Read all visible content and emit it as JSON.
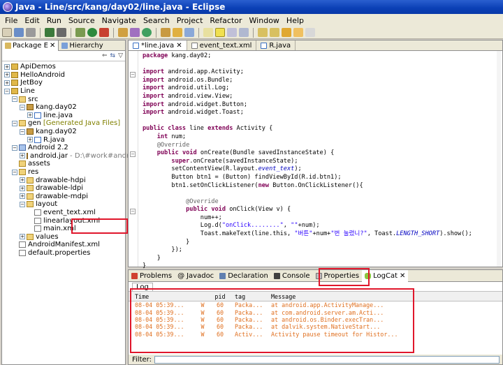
{
  "window": {
    "title": "Java - Line/src/kang/day02/line.java - Eclipse"
  },
  "menu": [
    "File",
    "Edit",
    "Run",
    "Source",
    "Navigate",
    "Search",
    "Project",
    "Refactor",
    "Window",
    "Help"
  ],
  "left_panel": {
    "tab_package": "Package E",
    "tab_hierarchy": "Hierarchy",
    "tree": [
      {
        "label": "ApiDemos",
        "icon": "project-icon",
        "depth": 0,
        "exp": "+"
      },
      {
        "label": "HelloAndroid",
        "icon": "project-icon",
        "depth": 0,
        "exp": "+"
      },
      {
        "label": "JetBoy",
        "icon": "project-icon",
        "depth": 0,
        "exp": "+"
      },
      {
        "label": "Line",
        "icon": "project-icon",
        "depth": 0,
        "exp": "-"
      },
      {
        "label": "src",
        "icon": "folder-icon",
        "depth": 1,
        "exp": "-"
      },
      {
        "label": "kang.day02",
        "icon": "package-icon",
        "depth": 2,
        "exp": "-"
      },
      {
        "label": "line.java",
        "icon": "java-file-icon",
        "depth": 3,
        "exp": "+"
      },
      {
        "label": "gen",
        "extra": "[Generated Java Files]",
        "icon": "folder-icon",
        "depth": 1,
        "exp": "-"
      },
      {
        "label": "kang.day02",
        "icon": "package-icon",
        "depth": 2,
        "exp": "-"
      },
      {
        "label": "R.java",
        "icon": "java-file-icon",
        "depth": 3,
        "exp": "+"
      },
      {
        "label": "Android 2.2",
        "icon": "library-icon",
        "depth": 1,
        "exp": "-"
      },
      {
        "label": "android.jar",
        "extra": "- D:\\#work#andro",
        "icon": "jar-icon",
        "depth": 2,
        "exp": "+"
      },
      {
        "label": "assets",
        "icon": "folder-icon",
        "depth": 1,
        "exp": ""
      },
      {
        "label": "res",
        "icon": "folder-icon",
        "depth": 1,
        "exp": "-"
      },
      {
        "label": "drawable-hdpi",
        "icon": "folder-icon",
        "depth": 2,
        "exp": "+"
      },
      {
        "label": "drawable-ldpi",
        "icon": "folder-icon",
        "depth": 2,
        "exp": "+"
      },
      {
        "label": "drawable-mdpi",
        "icon": "folder-icon",
        "depth": 2,
        "exp": "+"
      },
      {
        "label": "layout",
        "icon": "folder-icon",
        "depth": 2,
        "exp": "-"
      },
      {
        "label": "event_text.xml",
        "icon": "xml-file-icon",
        "depth": 3,
        "exp": ""
      },
      {
        "label": "linearlayout.xml",
        "icon": "xml-file-icon",
        "depth": 3,
        "exp": ""
      },
      {
        "label": "main.xml",
        "icon": "xml-file-icon",
        "depth": 3,
        "exp": ""
      },
      {
        "label": "values",
        "icon": "folder-icon",
        "depth": 2,
        "exp": "+"
      },
      {
        "label": "AndroidManifest.xml",
        "icon": "xml-file-icon",
        "depth": 1,
        "exp": ""
      },
      {
        "label": "default.properties",
        "icon": "xml-file-icon",
        "depth": 1,
        "exp": ""
      }
    ]
  },
  "editor": {
    "tabs": [
      "*line.java",
      "event_text.xml",
      "R.java"
    ],
    "lines": [
      "package kang.day02;",
      "",
      "import android.app.Activity;",
      "import android.os.Bundle;",
      "import android.util.Log;",
      "import android.view.View;",
      "import android.widget.Button;",
      "import android.widget.Toast;",
      "",
      "public class line extends Activity {",
      "    int num;",
      "    @Override",
      "    public void onCreate(Bundle savedInstanceState) {",
      "        super.onCreate(savedInstanceState);",
      "        setContentView(R.layout.event_text);",
      "        Button btn1 = (Button) findViewById(R.id.btn1);",
      "        btn1.setOnClickListener(new Button.OnClickListener(){",
      "",
      "            @Override",
      "            public void onClick(View v) {",
      "                num++;",
      "                Log.d(\"onClick........\", \"\"+num);",
      "                Toast.makeText(line.this, \"버튼\"+num+\"번 눌렸니?\", Toast.LENGTH_SHORT).show();",
      "            }",
      "        });",
      "    }",
      "}"
    ]
  },
  "bottom_panel": {
    "tabs": [
      "Problems",
      "Javadoc",
      "Declaration",
      "Console",
      "Properties",
      "LogCat"
    ],
    "sub_tab": "Log",
    "columns": [
      "Time",
      "",
      "pid",
      "tag",
      "Message"
    ],
    "rows": [
      {
        "time": "08-04 05:39...",
        "level": "W",
        "pid": "60",
        "tag": "Packa...",
        "msg": "at android.app.ActivityManage..."
      },
      {
        "time": "08-04 05:39...",
        "level": "W",
        "pid": "60",
        "tag": "Packa...",
        "msg": "at com.android.server.am.Acti..."
      },
      {
        "time": "08-04 05:39...",
        "level": "W",
        "pid": "60",
        "tag": "Packa...",
        "msg": "at android.os.Binder.execTran..."
      },
      {
        "time": "08-04 05:39...",
        "level": "W",
        "pid": "60",
        "tag": "Packa...",
        "msg": "at dalvik.system.NativeStart..."
      },
      {
        "time": "08-04 05:39...",
        "level": "W",
        "pid": "60",
        "tag": "Activ...",
        "msg": "Activity pause timeout for Histor..."
      }
    ],
    "filter_label": "Filter:"
  },
  "colors": {
    "highlight_box": "#e0162b",
    "log_warn": "#e07020",
    "keyword": "#7f0055"
  }
}
